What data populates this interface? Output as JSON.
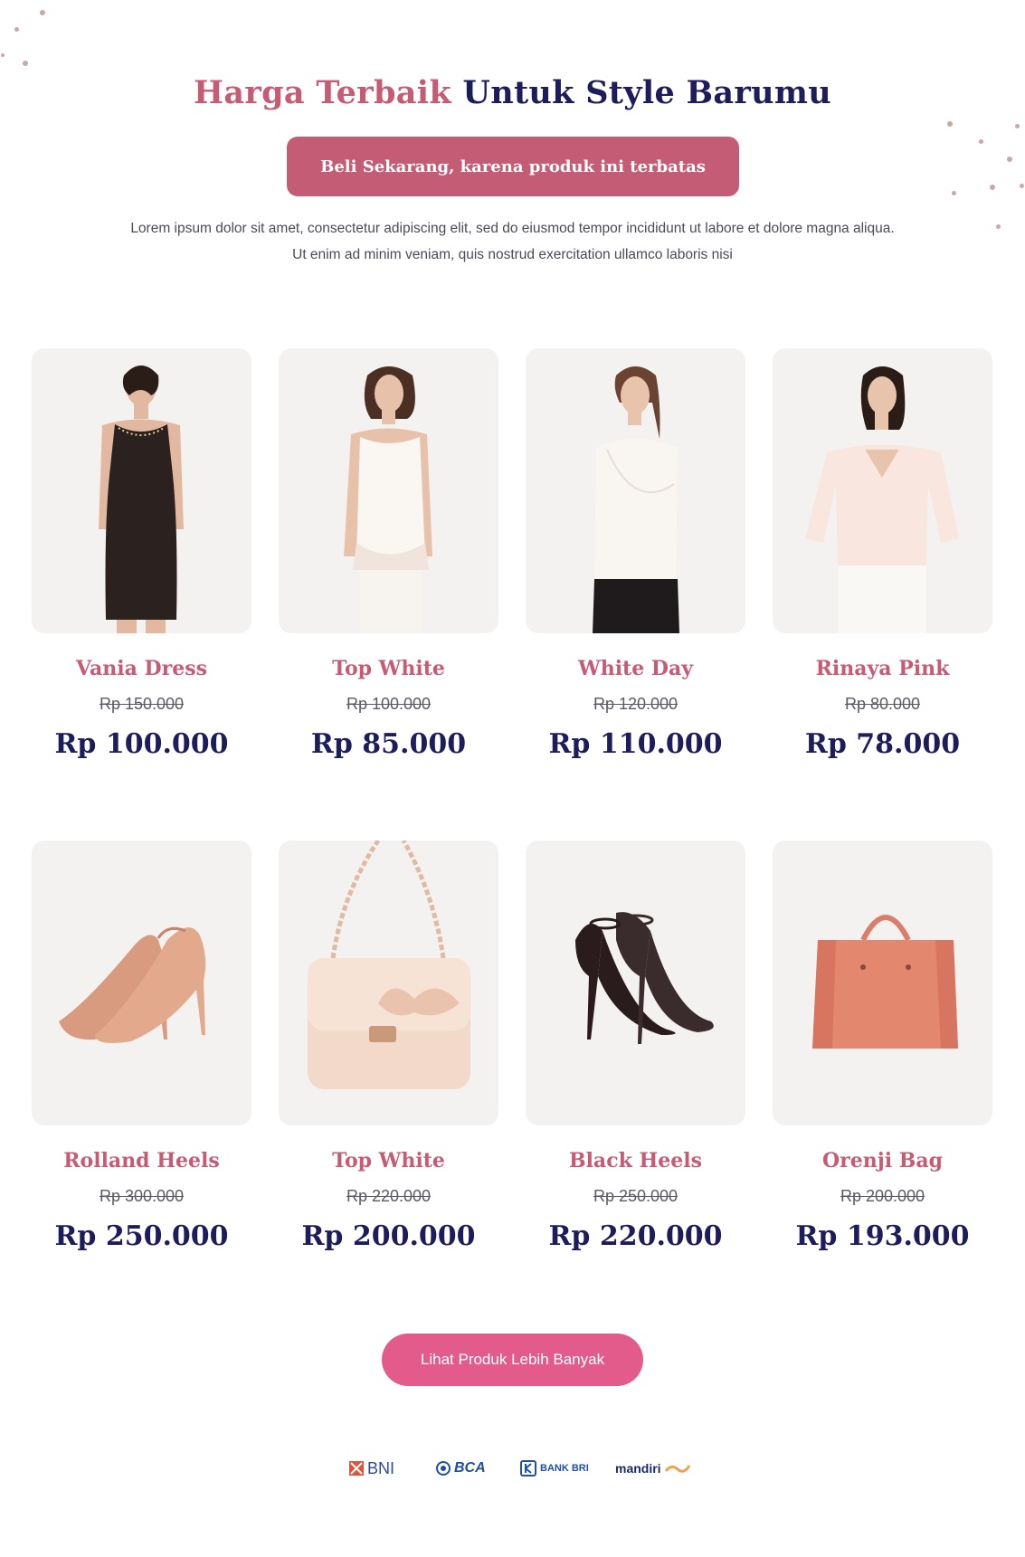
{
  "hero": {
    "headline_pink": "Harga Terbaik",
    "headline_navy": "Untuk Style Barumu",
    "cta_label": "Beli Sekarang, karena produk ini terbatas",
    "intro_text": "Lorem ipsum dolor sit amet, consectetur adipiscing elit, sed do eiusmod tempor incididunt ut labore et dolore magna aliqua. Ut enim ad minim veniam, quis nostrud exercitation ullamco laboris nisi"
  },
  "products": [
    {
      "name": "Vania Dress",
      "old_price": "Rp 150.000",
      "price": "Rp 100.000",
      "image": "black-dress-photo"
    },
    {
      "name": "Top White",
      "old_price": "Rp 100.000",
      "price": "Rp 85.000",
      "image": "white-top-photo"
    },
    {
      "name": "White Day",
      "old_price": "Rp 120.000",
      "price": "Rp 110.000",
      "image": "white-wrap-top-photo"
    },
    {
      "name": "Rinaya Pink",
      "old_price": "Rp 80.000",
      "price": "Rp 78.000",
      "image": "pink-blouse-photo"
    },
    {
      "name": "Rolland Heels",
      "old_price": "Rp 300.000",
      "price": "Rp 250.000",
      "image": "nude-heels-photo"
    },
    {
      "name": "Top White",
      "old_price": "Rp 220.000",
      "price": "Rp 200.000",
      "image": "lace-bag-photo"
    },
    {
      "name": "Black Heels",
      "old_price": "Rp 250.000",
      "price": "Rp 220.000",
      "image": "black-sandal-heels-photo"
    },
    {
      "name": "Orenji Bag",
      "old_price": "Rp 200.000",
      "price": "Rp 193.000",
      "image": "orange-tote-photo"
    }
  ],
  "more_button_label": "Lihat Produk Lebih Banyak",
  "banks": [
    {
      "label": "BNI",
      "icon": "bni-logo"
    },
    {
      "label": "BCA",
      "icon": "bca-logo"
    },
    {
      "label": "BANK BRI",
      "icon": "bri-logo"
    },
    {
      "label": "mandiri",
      "icon": "mandiri-logo"
    }
  ],
  "colors": {
    "accent_pink": "#c75b74",
    "navy": "#1d1d5c",
    "button_pink": "#e25b8a",
    "card_bg": "#f3f2f1"
  }
}
